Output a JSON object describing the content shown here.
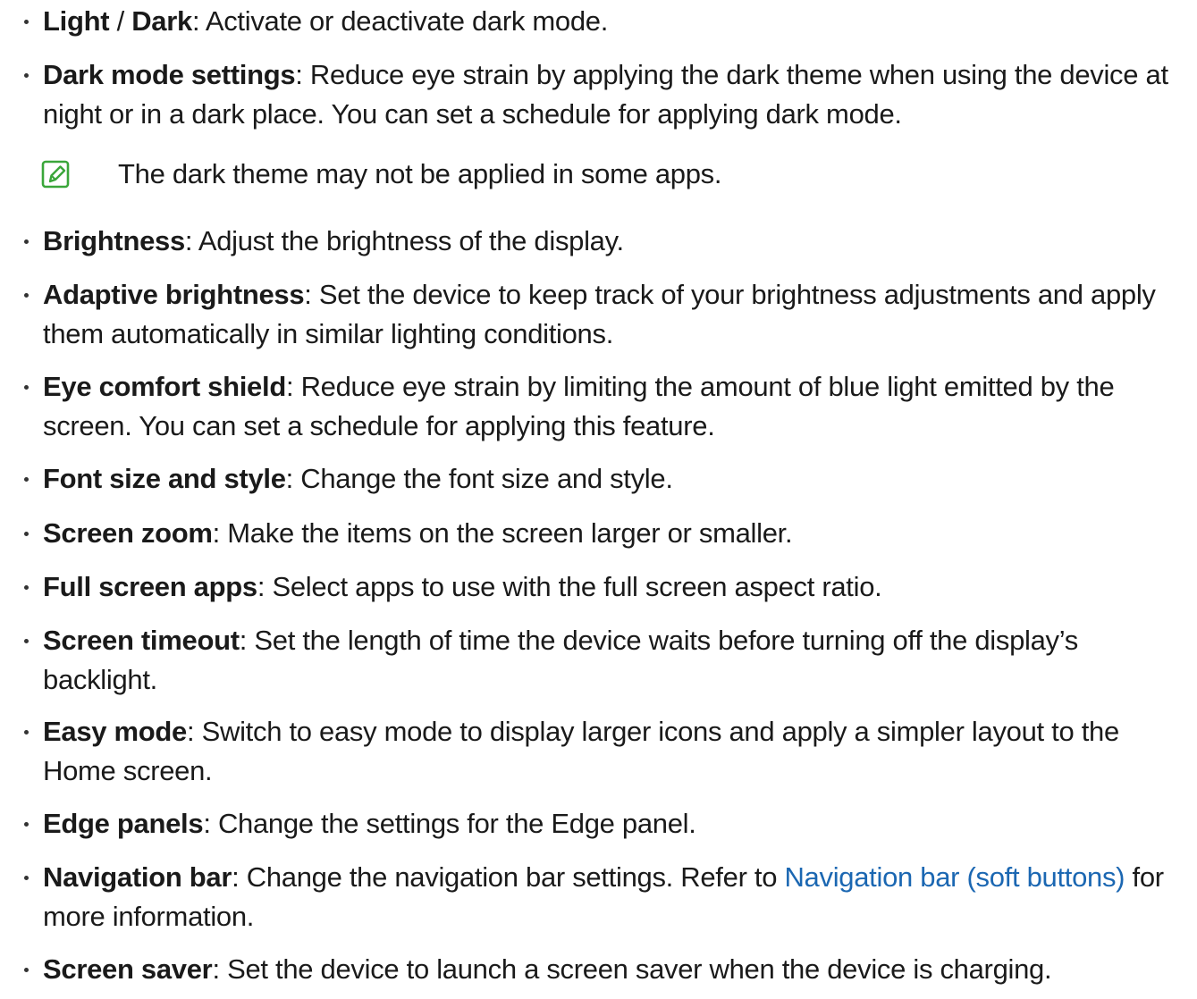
{
  "items": [
    {
      "term": "Light",
      "sep": " / ",
      "term2": "Dark",
      "desc": ": Activate or deactivate dark mode."
    },
    {
      "term": "Dark mode settings",
      "desc": ": Reduce eye strain by applying the dark theme when using the device at night or in a dark place. You can set a schedule for applying dark mode."
    },
    {
      "term": "Brightness",
      "desc": ": Adjust the brightness of the display."
    },
    {
      "term": "Adaptive brightness",
      "desc": ": Set the device to keep track of your brightness adjustments and apply them automatically in similar lighting conditions."
    },
    {
      "term": "Eye comfort shield",
      "desc": ": Reduce eye strain by limiting the amount of blue light emitted by the screen. You can set a schedule for applying this feature."
    },
    {
      "term": "Font size and style",
      "desc": ": Change the font size and style."
    },
    {
      "term": "Screen zoom",
      "desc": ": Make the items on the screen larger or smaller."
    },
    {
      "term": "Full screen apps",
      "desc": ": Select apps to use with the full screen aspect ratio."
    },
    {
      "term": "Screen timeout",
      "desc": ": Set the length of time the device waits before turning off the display’s backlight."
    },
    {
      "term": "Easy mode",
      "desc": ": Switch to easy mode to display larger icons and apply a simpler layout to the Home screen."
    },
    {
      "term": "Edge panels",
      "desc": ": Change the settings for the Edge panel."
    },
    {
      "term": "Navigation bar",
      "desc": ": Change the navigation bar settings. Refer to ",
      "link": "Navigation bar (soft buttons)",
      "desc_after": " for more information."
    },
    {
      "term": "Screen saver",
      "desc": ": Set the device to launch a screen saver when the device is charging."
    }
  ],
  "note": {
    "icon": "note-icon",
    "text": "The dark theme may not be applied in some apps."
  },
  "colors": {
    "link": "#1b67b2",
    "note_icon": "#3aa63a",
    "text": "#1a1a1a"
  }
}
